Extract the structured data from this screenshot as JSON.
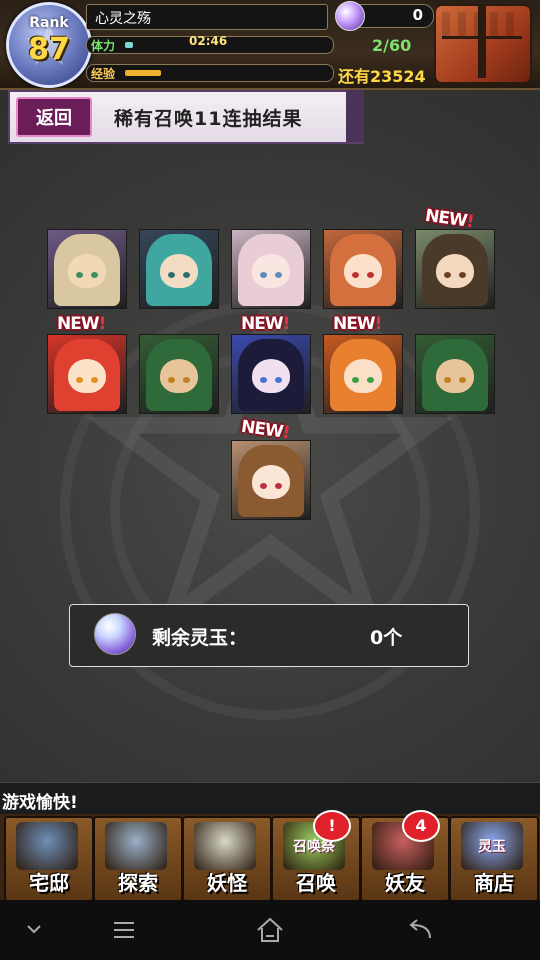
{
  "player": {
    "rank_label": "Rank",
    "rank_value": "87",
    "name": "心灵之殇",
    "stamina_label": "体力",
    "stamina_timer": "02:46",
    "stamina_value": "2/60",
    "stamina_fraction": 0.04,
    "exp_label": "经验",
    "exp_fraction": 0.18,
    "exp_remaining": "还有23524",
    "crystal_count": "0"
  },
  "header": {
    "back_label": "返回",
    "title": "稀有召唤11连抽结果"
  },
  "cards": [
    {
      "name": "yokai-card-1",
      "hair": "#d8c7a0",
      "skin": "#f1d9b5",
      "eyes": "#3c8f60",
      "bg": "#6d5a85",
      "is_new": false
    },
    {
      "name": "yokai-card-2",
      "hair": "#3fa6a0",
      "skin": "#f3dcc4",
      "eyes": "#2b6f6a",
      "bg": "#37465a",
      "is_new": false
    },
    {
      "name": "yokai-card-3",
      "hair": "#e8cdd6",
      "skin": "#fae6e0",
      "eyes": "#5f8bbb",
      "bg": "#c9b3c2",
      "is_new": false
    },
    {
      "name": "yokai-card-4",
      "hair": "#d4703e",
      "skin": "#fbe0cc",
      "eyes": "#c03030",
      "bg": "#c2683c",
      "is_new": false
    },
    {
      "name": "yokai-card-5",
      "hair": "#4a3a2a",
      "skin": "#f3d8c0",
      "eyes": "#6a4020",
      "bg": "#7a8a6a",
      "is_new": true
    },
    {
      "name": "yokai-card-6",
      "hair": "#e04030",
      "skin": "#fbe2c8",
      "eyes": "#e09020",
      "bg": "#d83428",
      "is_new": true
    },
    {
      "name": "yokai-card-7",
      "hair": "#2f6a3a",
      "skin": "#e8c49a",
      "eyes": "#c08020",
      "bg": "#345c34",
      "is_new": false
    },
    {
      "name": "yokai-card-8",
      "hair": "#1c1c3a",
      "skin": "#f1e0f0",
      "eyes": "#4a70d0",
      "bg": "#3a4ab0",
      "is_new": true
    },
    {
      "name": "yokai-card-9",
      "hair": "#e88030",
      "skin": "#fbe0c8",
      "eyes": "#3aa040",
      "bg": "#c85a20",
      "is_new": true
    },
    {
      "name": "yokai-card-10",
      "hair": "#2f6a3a",
      "skin": "#e8c49a",
      "eyes": "#c08020",
      "bg": "#345c34",
      "is_new": false
    },
    {
      "name": "yokai-card-11",
      "hair": "#8a5a30",
      "skin": "#fbe6d6",
      "eyes": "#c03040",
      "bg": "#b89070",
      "is_new": true
    }
  ],
  "new_badge_text": {
    "main": "NEW",
    "mark": "!"
  },
  "remaining": {
    "label": "剩余灵玉：",
    "value": "0个"
  },
  "ticker": "游戏愉快!",
  "nav": [
    {
      "name": "nav-home",
      "label": "宅邸",
      "badge": "",
      "color": "#6f8fb8"
    },
    {
      "name": "nav-explore",
      "label": "探索",
      "badge": "",
      "color": "#9ab0c8"
    },
    {
      "name": "nav-yokai",
      "label": "妖怪",
      "badge": "",
      "color": "#d8d8c8"
    },
    {
      "name": "nav-summon",
      "label": "召唤",
      "badge": "!",
      "color": "#9ad060",
      "tag": "召唤祭"
    },
    {
      "name": "nav-friends",
      "label": "妖友",
      "badge": "4",
      "color": "#c86060"
    },
    {
      "name": "nav-shop",
      "label": "商店",
      "badge": "",
      "color": "#8aa8f0",
      "tag": "灵玉"
    }
  ],
  "icons": {
    "system_back": "back-arrow-icon",
    "system_home": "home-icon",
    "system_menu": "menu-icon",
    "system_down": "chevron-down-icon"
  }
}
